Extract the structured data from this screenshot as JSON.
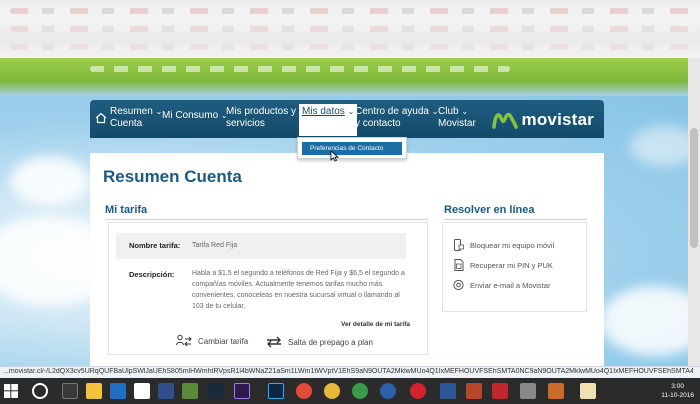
{
  "nav": {
    "resumen_line1": "Resumen",
    "resumen_line2": "Cuenta",
    "mi_consumo": "Mi Consumo",
    "productos_line1": "Mis productos y",
    "productos_line2": "servicios",
    "mis_datos": "Mis datos",
    "centro_line1": "Centro de ayuda",
    "centro_line2": "y contacto",
    "club_line1": "Club",
    "club_line2": "Movistar",
    "logo_text": "movistar",
    "chevron": "⌄"
  },
  "dropdown": {
    "item": "Preferencias de Contacto"
  },
  "page": {
    "title": "Resumen Cuenta"
  },
  "tarifa": {
    "section_title": "Mi tarifa",
    "nombre_label": "Nombre tarifa:",
    "nombre_value": "Tarifa Red Fija",
    "descripcion_label": "Descripción:",
    "descripcion_value": "Habla a $1,5 el segundo a teléfonos de Red Fija y $6,5 el segundo a compañías móviles. Actualmente tenemos tarifas mucho más convenientes, conoceleas en nuestra sucursal virtual o llamando al 103 de tu celular.",
    "ver_detalle": "Ver detalle de mi tarifa",
    "cambiar": "Cambiar tarifa",
    "salta": "Salta de prepago a plan"
  },
  "resolver": {
    "section_title": "Resolver en línea",
    "items": [
      "Bloquear mi equipo móvil",
      "Recuperar mi PIN y PUK",
      "Enviar e-mail a Movistar"
    ]
  },
  "statusbar": {
    "url": "...movistar.cl/-/L2dQX3cv5URqQUFBaUlpSWlJaUEhS805mlHWmhtRVpsR1l4bWNaZ21aSm1LWm1tWVptV1EhS9aN9OUTA2MklwMUo4Q1IxMEFHOUVFSEhSMTA0NC9aN9OUTA2MklwMUo4Q1IxMEFHOUVFSEhSMTA4NC9aN9OUTA2MklwMUo4Q1IxMEFHOUVFSEhSMTAyNC9aN9OUTA2Mk"
  },
  "taskbar": {
    "time": "3:00",
    "date": "11-10-2016"
  },
  "colors": {
    "nav_bg": "#174f70",
    "brand_green": "#84c242",
    "title_blue": "#1c5a82",
    "dropdown_highlight": "#1e6ea6"
  }
}
